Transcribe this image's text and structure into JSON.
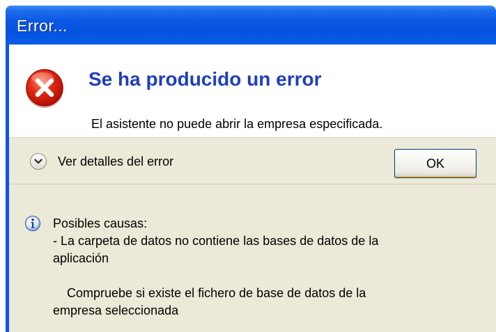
{
  "window": {
    "title": "Error..."
  },
  "header": {
    "heading": "Se ha producido un error",
    "message": "El asistente no puede abrir la empresa especificada.",
    "icon": "error-icon"
  },
  "actions": {
    "details_label": "Ver detalles del error",
    "ok_label": "OK"
  },
  "causes": {
    "icon": "info-icon",
    "title": "Posibles causas:",
    "line1": "- La carpeta de datos no contiene las bases de datos de la",
    "line2": "aplicación",
    "line3": "Compruebe si existe el fichero de base de datos de la",
    "line4": "empresa seleccionada"
  },
  "colors": {
    "titlebar": "#0a58e2",
    "heading": "#1f3fbe",
    "error_red": "#e02010",
    "face": "#ece9d8"
  }
}
